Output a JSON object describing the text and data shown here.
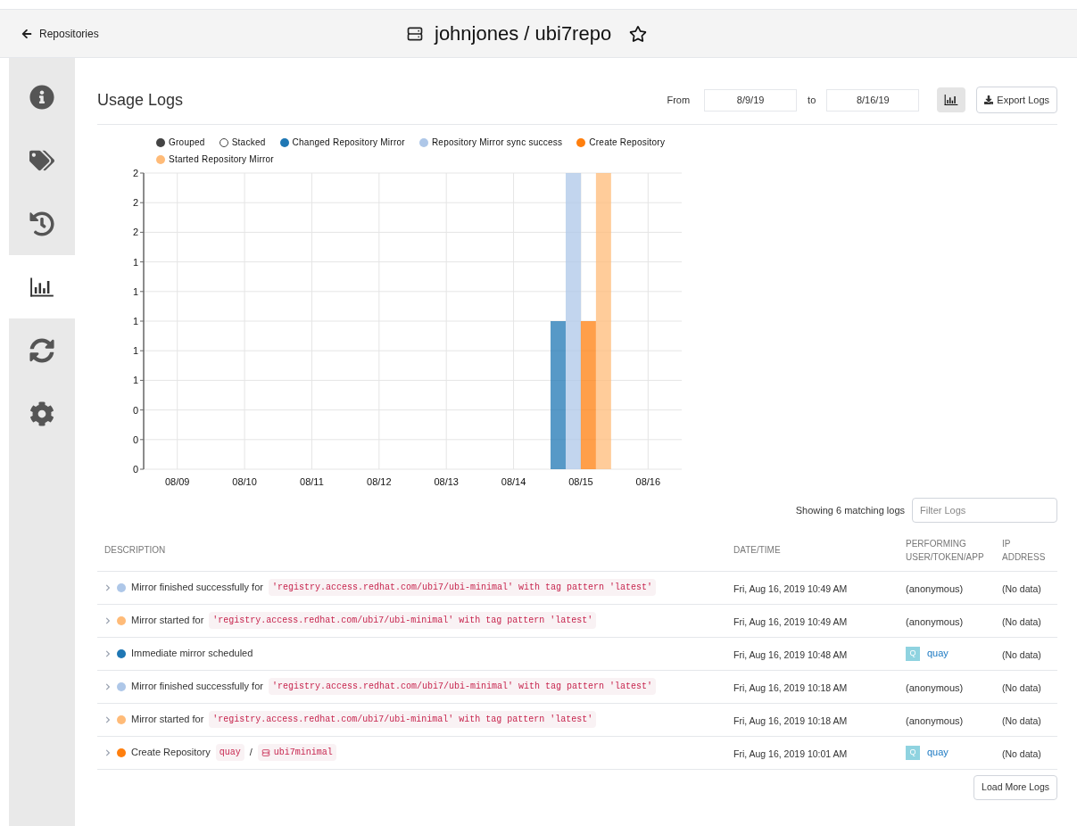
{
  "header": {
    "back_link": "Repositories",
    "repo_title": "johnjones / ubi7repo",
    "starred": false
  },
  "sidebar": {
    "items": [
      {
        "selected": false
      },
      {
        "selected": false
      },
      {
        "selected": false
      },
      {
        "selected": true
      },
      {
        "selected": false
      },
      {
        "selected": false
      }
    ]
  },
  "usage_logs": {
    "title": "Usage Logs",
    "from_label": "From",
    "from_value": "8/9/19",
    "to_label": "to",
    "to_value": "8/16/19",
    "chart_toggle": {
      "on": true
    },
    "export_button": "Export Logs",
    "chart_modes": [
      {
        "label": "Grouped",
        "selected": true
      },
      {
        "label": "Stacked",
        "selected": false
      }
    ],
    "chart_data": {
      "type": "bar",
      "categories": [
        "08/09",
        "08/10",
        "08/11",
        "08/12",
        "08/13",
        "08/14",
        "08/15",
        "08/16"
      ],
      "series": [
        {
          "name": "Changed Repository Mirror",
          "color": "#1f77b4",
          "values": [
            0,
            0,
            0,
            0,
            0,
            0,
            1,
            0
          ]
        },
        {
          "name": "Repository Mirror sync success",
          "color": "#aec7e8",
          "values": [
            0,
            0,
            0,
            0,
            0,
            0,
            2,
            0
          ]
        },
        {
          "name": "Create Repository",
          "color": "#ff7f0e",
          "values": [
            0,
            0,
            0,
            0,
            0,
            0,
            1,
            0
          ]
        },
        {
          "name": "Started Repository Mirror",
          "color": "#ffbb78",
          "values": [
            0,
            0,
            0,
            0,
            0,
            0,
            2,
            0
          ]
        }
      ],
      "ylim": [
        0,
        2
      ],
      "yticks": [
        {
          "value": 0,
          "label": "0"
        },
        {
          "value": 0.2,
          "label": "0"
        },
        {
          "value": 0.4,
          "label": "0"
        },
        {
          "value": 0.6,
          "label": "1"
        },
        {
          "value": 0.8,
          "label": "1"
        },
        {
          "value": 1,
          "label": "1"
        },
        {
          "value": 1.2,
          "label": "1"
        },
        {
          "value": 1.4,
          "label": "1"
        },
        {
          "value": 1.6,
          "label": "2"
        },
        {
          "value": 1.8,
          "label": "2"
        },
        {
          "value": 2,
          "label": "2"
        }
      ],
      "stacked": false,
      "grid": true
    },
    "matching_text": "Showing 6 matching logs",
    "filter_placeholder": "Filter Logs",
    "columns": [
      "DESCRIPTION",
      "DATE/TIME",
      "PERFORMING USER/TOKEN/APP",
      "IP ADDRESS"
    ],
    "rows": [
      {
        "kind": "mirror",
        "color": "#aec7e8",
        "text": "Mirror finished successfully for",
        "code": "'registry.access.redhat.com/ubi7/ubi-minimal' with tag pattern 'latest'",
        "datetime": "Fri, Aug 16, 2019 10:49 AM",
        "performer": {
          "kind": "anonymous",
          "name": "(anonymous)"
        },
        "ip": "(No data)"
      },
      {
        "kind": "mirror",
        "color": "#ffbb78",
        "text": "Mirror started for",
        "code": "'registry.access.redhat.com/ubi7/ubi-minimal' with tag pattern 'latest'",
        "datetime": "Fri, Aug 16, 2019 10:49 AM",
        "performer": {
          "kind": "anonymous",
          "name": "(anonymous)"
        },
        "ip": "(No data)"
      },
      {
        "kind": "plain",
        "color": "#1f77b4",
        "text": "Immediate mirror scheduled",
        "datetime": "Fri, Aug 16, 2019 10:48 AM",
        "performer": {
          "kind": "app",
          "avatar": "Q",
          "name": "quay"
        },
        "ip": "(No data)"
      },
      {
        "kind": "mirror",
        "color": "#aec7e8",
        "text": "Mirror finished successfully for",
        "code": "'registry.access.redhat.com/ubi7/ubi-minimal' with tag pattern 'latest'",
        "datetime": "Fri, Aug 16, 2019 10:18 AM",
        "performer": {
          "kind": "anonymous",
          "name": "(anonymous)"
        },
        "ip": "(No data)"
      },
      {
        "kind": "mirror",
        "color": "#ffbb78",
        "text": "Mirror started for",
        "code": "'registry.access.redhat.com/ubi7/ubi-minimal' with tag pattern 'latest'",
        "datetime": "Fri, Aug 16, 2019 10:18 AM",
        "performer": {
          "kind": "anonymous",
          "name": "(anonymous)"
        },
        "ip": "(No data)"
      },
      {
        "kind": "create",
        "color": "#ff7f0e",
        "text": "Create Repository",
        "namespace": "quay",
        "separator": "/",
        "repo": "ubi7minimal",
        "datetime": "Fri, Aug 16, 2019 10:01 AM",
        "performer": {
          "kind": "app",
          "avatar": "Q",
          "name": "quay"
        },
        "ip": "(No data)"
      }
    ],
    "load_more_button": "Load More Logs"
  }
}
